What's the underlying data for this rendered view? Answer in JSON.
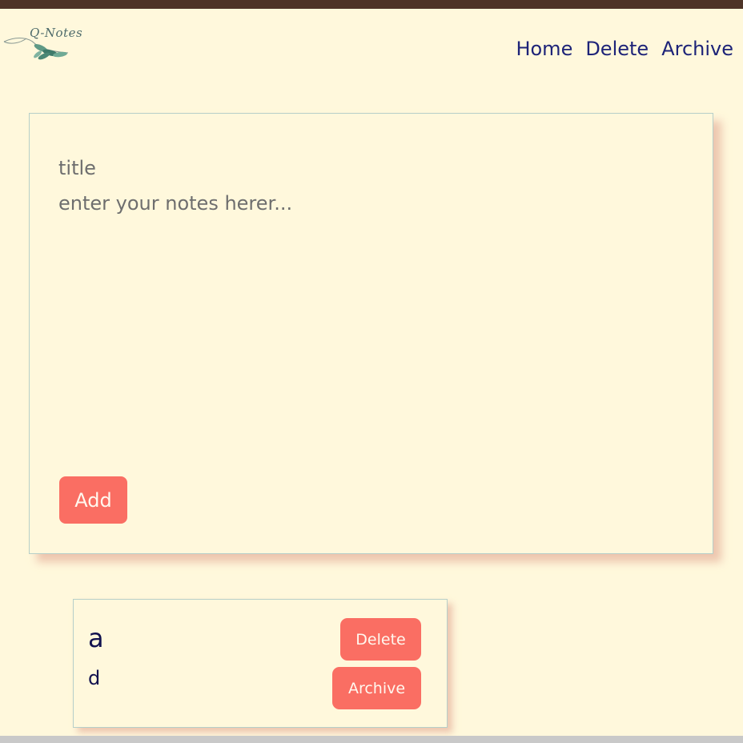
{
  "brand": {
    "logo_text": "Q-Notes"
  },
  "nav": {
    "items": [
      {
        "label": "Home"
      },
      {
        "label": "Delete"
      },
      {
        "label": "Archive"
      }
    ]
  },
  "composer": {
    "title_placeholder": "title",
    "notes_placeholder": "enter your notes herer...",
    "add_label": "Add"
  },
  "notes": [
    {
      "title": "a",
      "body": "d",
      "delete_label": "Delete",
      "archive_label": "Archive"
    }
  ],
  "colors": {
    "background": "#fff8dc",
    "top_bar": "#4e3427",
    "accent_button": "#fa6e63",
    "nav_text": "#1d2378",
    "note_text": "#11114f",
    "card_border": "#b6cfc9",
    "card_shadow": "#e7b5a0"
  },
  "icons": {
    "logo_leaf": "leaf-branch-icon"
  }
}
